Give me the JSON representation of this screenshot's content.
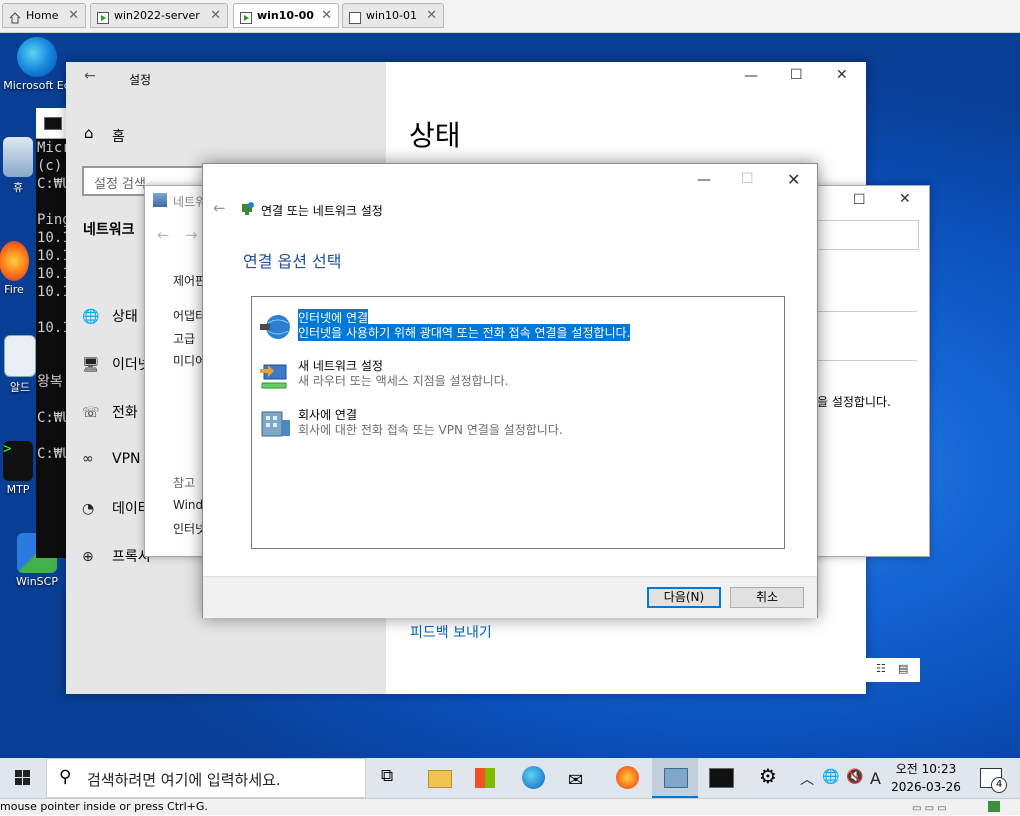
{
  "vm_tabs": [
    {
      "label": "Home"
    },
    {
      "label": "win2022-server"
    },
    {
      "label": "win10-00"
    },
    {
      "label": "win10-01"
    }
  ],
  "desktop_icons": [
    {
      "label": "Microsoft Ed"
    },
    {
      "label": "휴"
    },
    {
      "label": "Fire"
    },
    {
      "label": "알드"
    },
    {
      "label": "MTP"
    },
    {
      "label": "WinSCP"
    }
  ],
  "console": {
    "lines": [
      "Micr",
      "(c)",
      "C:₩U",
      "",
      "Ping",
      "10.1",
      "10.1",
      "10.1",
      "10.1",
      "",
      "10.1",
      "",
      "",
      "왕복",
      "",
      "C:₩U",
      "",
      "C:₩U"
    ]
  },
  "settings": {
    "title": "설정",
    "home": "홈",
    "search_placeholder": "설정 검색",
    "section": "네트워크",
    "nav": [
      {
        "label": "상태"
      },
      {
        "label": "이더넷"
      },
      {
        "label": "전화"
      },
      {
        "label": "VPN"
      },
      {
        "label": "데이터"
      },
      {
        "label": "프록시"
      }
    ],
    "page_title": "상태",
    "feedback": "피드백 보내기"
  },
  "network_window": {
    "title": "네트워",
    "side_items": [
      "제어판",
      "어댑터",
      "고급",
      "미디어",
      "참고",
      "Windo",
      "인터넷"
    ],
    "right_text": "을 설정합니다."
  },
  "wizard": {
    "title": "연결 또는 네트워크 설정",
    "heading": "연결 옵션 선택",
    "options": [
      {
        "title": "인터넷에 연결",
        "desc": "인터넷을 사용하기 위해 광대역 또는 전화 접속 연결을 설정합니다.",
        "selected": true
      },
      {
        "title": "새 네트워크 설정",
        "desc": "새 라우터 또는 액세스 지점을 설정합니다.",
        "selected": false
      },
      {
        "title": "회사에 연결",
        "desc": "회사에 대한 전화 접속 또는 VPN 연결을 설정합니다.",
        "selected": false
      }
    ],
    "next_button": "다음(N)",
    "cancel_button": "취소"
  },
  "taskbar": {
    "search_placeholder": "검색하려면 여기에 입력하세요.",
    "ime": "A",
    "time": "오전 10:23",
    "date": "2026-03-26",
    "notification_count": "4"
  },
  "vm_status": "mouse pointer inside or press Ctrl+G."
}
